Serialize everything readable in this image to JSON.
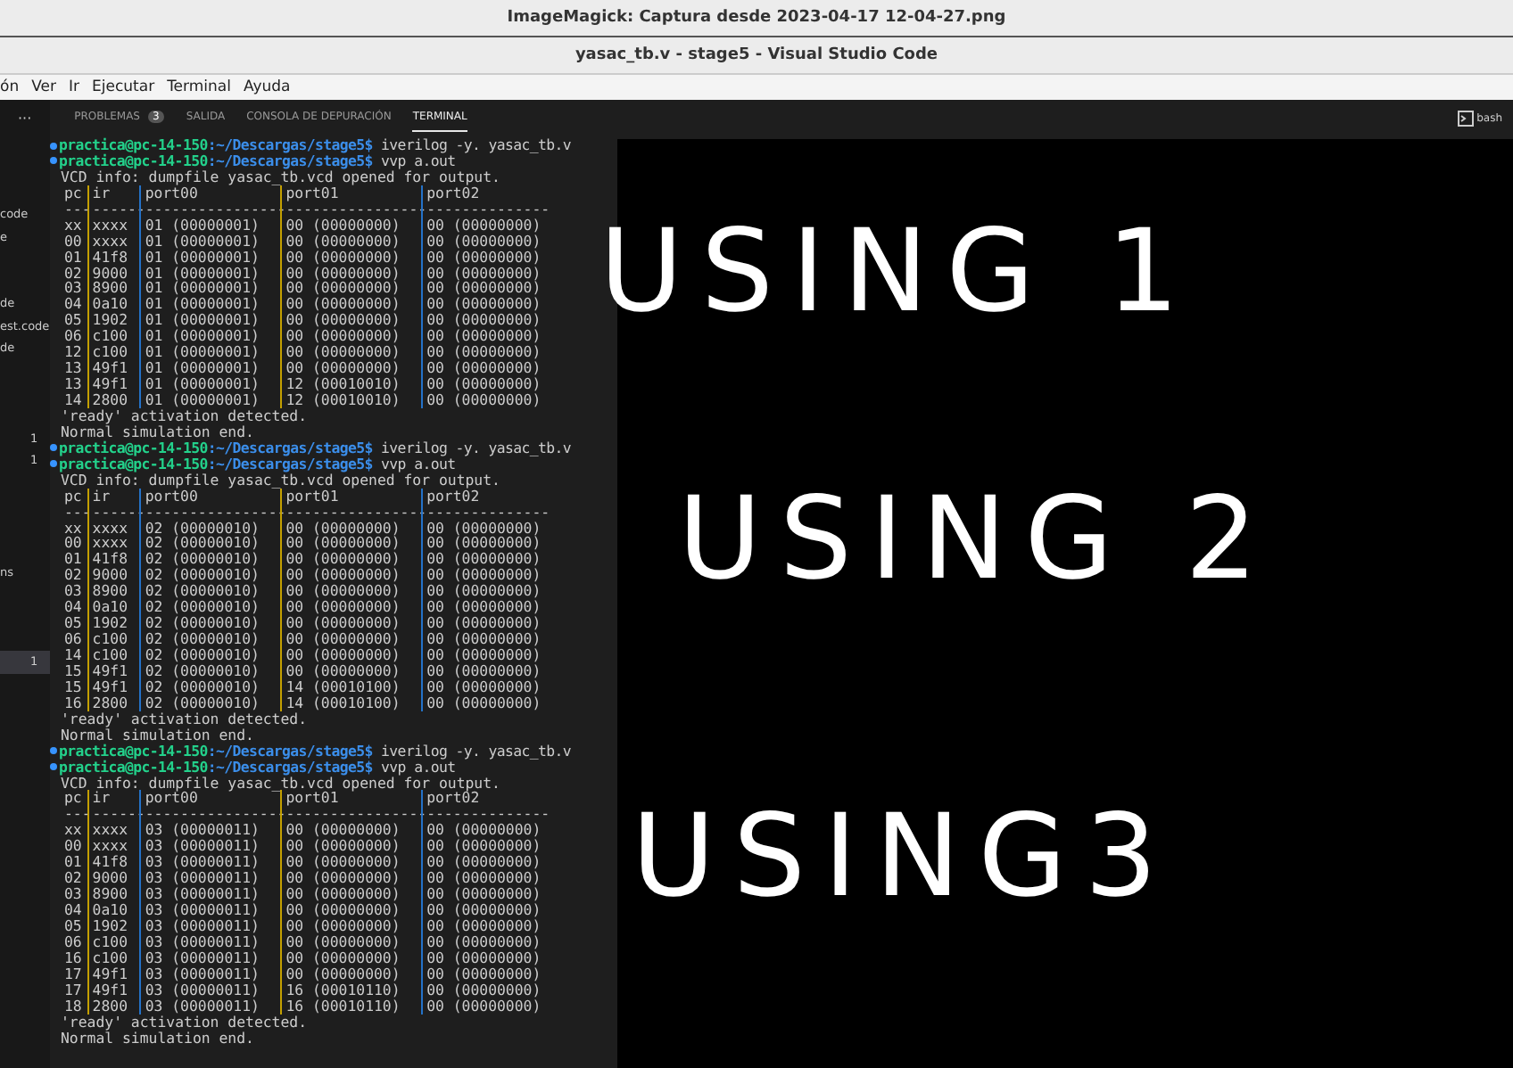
{
  "viewer_title": "ImageMagick: Captura desde 2023-04-17 12-04-27.png",
  "window": {
    "title": "yasac_tb.v - stage5 - Visual Studio Code"
  },
  "menu": [
    "ón",
    "Ver",
    "Ir",
    "Ejecutar",
    "Terminal",
    "Ayuda"
  ],
  "panel": {
    "more": "···",
    "tabs": [
      {
        "label": "PROBLEMAS",
        "badge": "3",
        "selected": false
      },
      {
        "label": "SALIDA",
        "selected": false
      },
      {
        "label": "CONSOLA DE DEPURACIÓN",
        "selected": false
      },
      {
        "label": "TERMINAL",
        "selected": true
      }
    ],
    "shell": "bash"
  },
  "sidebar_fragments": [
    {
      "text": "code",
      "selected": false
    },
    {
      "text": "e",
      "selected": false
    },
    {
      "text": "de",
      "selected": false
    },
    {
      "text": "est.code",
      "selected": false
    },
    {
      "text": "de",
      "selected": false
    },
    {
      "text": "1",
      "selected": false
    },
    {
      "text": "1",
      "selected": false
    },
    {
      "text": "ns",
      "selected": false
    },
    {
      "text": "1",
      "selected": true
    }
  ],
  "terminal": {
    "runs": [
      {
        "commands": [
          {
            "user": "practica@pc-14-150",
            "path": ":~/Descargas/stage5$",
            "command": "iverilog -y. yasac_tb.v"
          },
          {
            "user": "practica@pc-14-150",
            "path": ":~/Descargas/stage5$",
            "command": "vvp a.out"
          }
        ],
        "info": "VCD info: dumpfile yasac_tb.vcd opened for output.",
        "columns": [
          "pc",
          "ir",
          "port00",
          "port01",
          "port02"
        ],
        "separator": [
          "---",
          "------",
          "----------------",
          "----------------",
          "--------------"
        ],
        "rows": [
          [
            "xx",
            "xxxx",
            "01 (00000001)",
            "00 (00000000)",
            "00 (00000000)"
          ],
          [
            "00",
            "xxxx",
            "01 (00000001)",
            "00 (00000000)",
            "00 (00000000)"
          ],
          [
            "01",
            "41f8",
            "01 (00000001)",
            "00 (00000000)",
            "00 (00000000)"
          ],
          [
            "02",
            "9000",
            "01 (00000001)",
            "00 (00000000)",
            "00 (00000000)"
          ],
          [
            "03",
            "8900",
            "01 (00000001)",
            "00 (00000000)",
            "00 (00000000)"
          ],
          [
            "04",
            "0a10",
            "01 (00000001)",
            "00 (00000000)",
            "00 (00000000)"
          ],
          [
            "05",
            "1902",
            "01 (00000001)",
            "00 (00000000)",
            "00 (00000000)"
          ],
          [
            "06",
            "c100",
            "01 (00000001)",
            "00 (00000000)",
            "00 (00000000)"
          ],
          [
            "12",
            "c100",
            "01 (00000001)",
            "00 (00000000)",
            "00 (00000000)"
          ],
          [
            "13",
            "49f1",
            "01 (00000001)",
            "00 (00000000)",
            "00 (00000000)"
          ],
          [
            "13",
            "49f1",
            "01 (00000001)",
            "12 (00010010)",
            "00 (00000000)"
          ],
          [
            "14",
            "2800",
            "01 (00000001)",
            "12 (00010010)",
            "00 (00000000)"
          ]
        ],
        "messages": [
          "'ready' activation detected.",
          "Normal simulation end."
        ]
      },
      {
        "commands": [
          {
            "user": "practica@pc-14-150",
            "path": ":~/Descargas/stage5$",
            "command": "iverilog -y. yasac_tb.v"
          },
          {
            "user": "practica@pc-14-150",
            "path": ":~/Descargas/stage5$",
            "command": "vvp a.out"
          }
        ],
        "info": "VCD info: dumpfile yasac_tb.vcd opened for output.",
        "columns": [
          "pc",
          "ir",
          "port00",
          "port01",
          "port02"
        ],
        "separator": [
          "---",
          "------",
          "----------------",
          "----------------",
          "--------------"
        ],
        "rows": [
          [
            "xx",
            "xxxx",
            "02 (00000010)",
            "00 (00000000)",
            "00 (00000000)"
          ],
          [
            "00",
            "xxxx",
            "02 (00000010)",
            "00 (00000000)",
            "00 (00000000)"
          ],
          [
            "01",
            "41f8",
            "02 (00000010)",
            "00 (00000000)",
            "00 (00000000)"
          ],
          [
            "02",
            "9000",
            "02 (00000010)",
            "00 (00000000)",
            "00 (00000000)"
          ],
          [
            "03",
            "8900",
            "02 (00000010)",
            "00 (00000000)",
            "00 (00000000)"
          ],
          [
            "04",
            "0a10",
            "02 (00000010)",
            "00 (00000000)",
            "00 (00000000)"
          ],
          [
            "05",
            "1902",
            "02 (00000010)",
            "00 (00000000)",
            "00 (00000000)"
          ],
          [
            "06",
            "c100",
            "02 (00000010)",
            "00 (00000000)",
            "00 (00000000)"
          ],
          [
            "14",
            "c100",
            "02 (00000010)",
            "00 (00000000)",
            "00 (00000000)"
          ],
          [
            "15",
            "49f1",
            "02 (00000010)",
            "00 (00000000)",
            "00 (00000000)"
          ],
          [
            "15",
            "49f1",
            "02 (00000010)",
            "14 (00010100)",
            "00 (00000000)"
          ],
          [
            "16",
            "2800",
            "02 (00000010)",
            "14 (00010100)",
            "00 (00000000)"
          ]
        ],
        "messages": [
          "'ready' activation detected.",
          "Normal simulation end."
        ]
      },
      {
        "commands": [
          {
            "user": "practica@pc-14-150",
            "path": ":~/Descargas/stage5$",
            "command": "iverilog -y. yasac_tb.v"
          },
          {
            "user": "practica@pc-14-150",
            "path": ":~/Descargas/stage5$",
            "command": "vvp a.out"
          }
        ],
        "info": "VCD info: dumpfile yasac_tb.vcd opened for output.",
        "columns": [
          "pc",
          "ir",
          "port00",
          "port01",
          "port02"
        ],
        "separator": [
          "---",
          "------",
          "----------------",
          "----------------",
          "--------------"
        ],
        "rows": [
          [
            "xx",
            "xxxx",
            "03 (00000011)",
            "00 (00000000)",
            "00 (00000000)"
          ],
          [
            "00",
            "xxxx",
            "03 (00000011)",
            "00 (00000000)",
            "00 (00000000)"
          ],
          [
            "01",
            "41f8",
            "03 (00000011)",
            "00 (00000000)",
            "00 (00000000)"
          ],
          [
            "02",
            "9000",
            "03 (00000011)",
            "00 (00000000)",
            "00 (00000000)"
          ],
          [
            "03",
            "8900",
            "03 (00000011)",
            "00 (00000000)",
            "00 (00000000)"
          ],
          [
            "04",
            "0a10",
            "03 (00000011)",
            "00 (00000000)",
            "00 (00000000)"
          ],
          [
            "05",
            "1902",
            "03 (00000011)",
            "00 (00000000)",
            "00 (00000000)"
          ],
          [
            "06",
            "c100",
            "03 (00000011)",
            "00 (00000000)",
            "00 (00000000)"
          ],
          [
            "16",
            "c100",
            "03 (00000011)",
            "00 (00000000)",
            "00 (00000000)"
          ],
          [
            "17",
            "49f1",
            "03 (00000011)",
            "00 (00000000)",
            "00 (00000000)"
          ],
          [
            "17",
            "49f1",
            "03 (00000011)",
            "16 (00010110)",
            "00 (00000000)"
          ],
          [
            "18",
            "2800",
            "03 (00000011)",
            "16 (00010110)",
            "00 (00000000)"
          ]
        ],
        "messages": [
          "'ready' activation detected.",
          "Normal simulation end."
        ]
      }
    ]
  },
  "handwritten_notes": [
    "USING 1",
    "USING 2",
    "USING3"
  ]
}
